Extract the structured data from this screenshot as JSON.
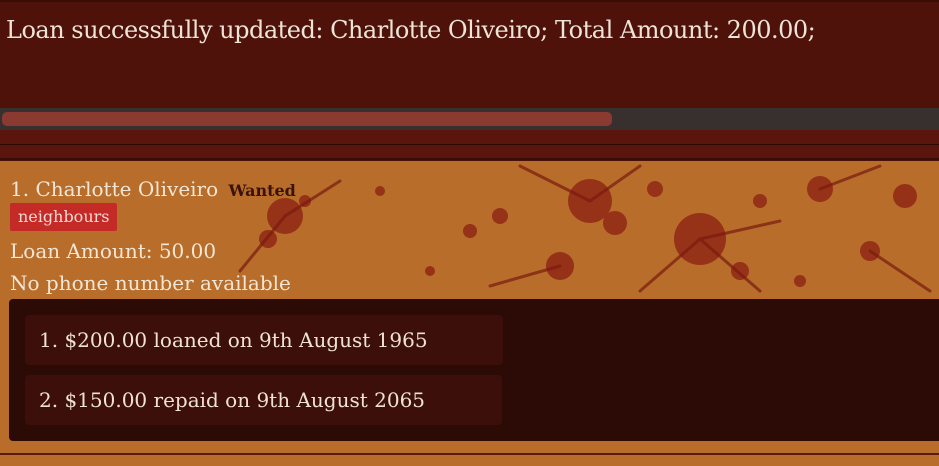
{
  "result": {
    "message": "Loan successfully updated: Charlotte Oliveiro; Total Amount: 200.00;"
  },
  "person": {
    "index": "1.",
    "name": "Charlotte Oliveiro",
    "status": "Wanted",
    "tag": "neighbours",
    "loan_amount": "Loan Amount: 50.00",
    "phone": "No phone number available"
  },
  "transactions": [
    {
      "text": "1. $200.00 loaned on 9th August 1965"
    },
    {
      "text": "2. $150.00 repaid on 9th August 2065"
    }
  ],
  "colors": {
    "background": "#4a1008",
    "card": "#b86e2a",
    "tag": "#c42a26",
    "panel": "#2c0a06"
  }
}
